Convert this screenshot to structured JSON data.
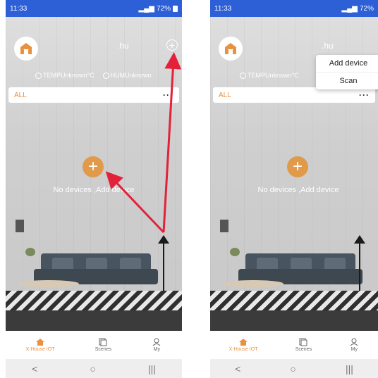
{
  "status_bar": {
    "time": "11:33",
    "battery": "72%",
    "icons": [
      "location-icon",
      "bluetooth-icon",
      "wifi-icon",
      "signal-icon",
      "battery-icon"
    ]
  },
  "header": {
    "username": ".hu",
    "logo_icon": "x-house-logo",
    "add_icon": "plus-circle-icon"
  },
  "environment": {
    "temp": "TEMPUnknown°C",
    "hum": "HUMUnknown"
  },
  "filter_bar": {
    "label": "ALL",
    "more": "···"
  },
  "empty_state": {
    "message": "No devices ,Add device",
    "add_icon": "plus-icon"
  },
  "dropdown": {
    "items": [
      "Add device",
      "Scan"
    ]
  },
  "bottom_nav": [
    {
      "label": "X-House IOT",
      "icon": "home-icon",
      "active": true
    },
    {
      "label": "Scenes",
      "icon": "scenes-icon",
      "active": false
    },
    {
      "label": "My",
      "icon": "user-icon",
      "active": false
    }
  ],
  "system_nav": {
    "back": "<",
    "home": "○",
    "recent": "|||"
  },
  "colors": {
    "status_bar": "#2d5fd6",
    "accent": "#e8913f",
    "annotation_arrow": "#e3213a"
  }
}
